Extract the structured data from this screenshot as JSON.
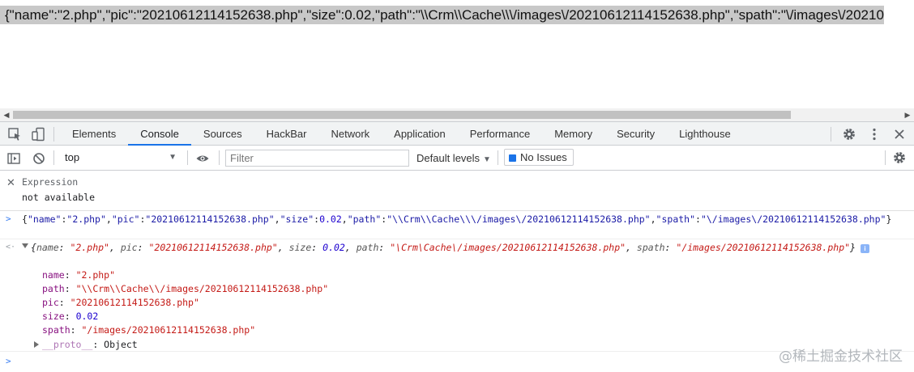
{
  "page": {
    "json_text": "{\"name\":\"2.php\",\"pic\":\"20210612114152638.php\",\"size\":0.02,\"path\":\"\\\\Crm\\\\Cache\\\\\\/images\\/20210612114152638.php\",\"spath\":\"\\/images\\/20210"
  },
  "devtools": {
    "tabs": [
      "Elements",
      "Console",
      "Sources",
      "HackBar",
      "Network",
      "Application",
      "Performance",
      "Memory",
      "Security",
      "Lighthouse"
    ],
    "active_tab": "Console",
    "icons": {
      "inspect": "inspect-element-icon",
      "device": "device-toolbar-icon",
      "settings": "gear-icon",
      "more": "more-vertical-icon",
      "close": "close-icon"
    }
  },
  "console_toolbar": {
    "context": "top",
    "filter_placeholder": "Filter",
    "levels": "Default levels",
    "issues": "No Issues"
  },
  "live_expression": {
    "expression": "Expression",
    "result": "not available"
  },
  "messages": {
    "command": {
      "open": "{",
      "k_name": "\"name\"",
      "v_name": "\"2.php\"",
      "k_pic": "\"pic\"",
      "v_pic": "\"20210612114152638.php\"",
      "k_size": "\"size\"",
      "v_size": "0.02",
      "k_path": "\"path\"",
      "v_path": "\"\\\\Crm\\\\Cache\\\\\\/images\\/20210612114152638.php\"",
      "k_spath": "\"spath\"",
      "v_spath": "\"\\/images\\/20210612114152638.php\"",
      "close": "}"
    },
    "result": {
      "preview": {
        "k_name": "name",
        "v_name": "\"2.php\"",
        "k_pic": "pic",
        "v_pic": "\"20210612114152638.php\"",
        "k_size": "size",
        "v_size": "0.02",
        "k_path": "path",
        "v_path": "\"\\Crm\\Cache\\/images/20210612114152638.php\"",
        "k_spath": "spath",
        "v_spath": "\"/images/20210612114152638.php\""
      },
      "properties": [
        {
          "key": "name",
          "value": "\"2.php\""
        },
        {
          "key": "path",
          "value": "\"\\\\Crm\\\\Cache\\\\/images/20210612114152638.php\""
        },
        {
          "key": "pic",
          "value": "\"20210612114152638.php\""
        },
        {
          "key": "size",
          "value": "0.02"
        },
        {
          "key": "spath",
          "value": "\"/images/20210612114152638.php\""
        }
      ],
      "proto_key": "__proto__",
      "proto_value": "Object"
    }
  },
  "watermark": "@稀土掘金技术社区"
}
